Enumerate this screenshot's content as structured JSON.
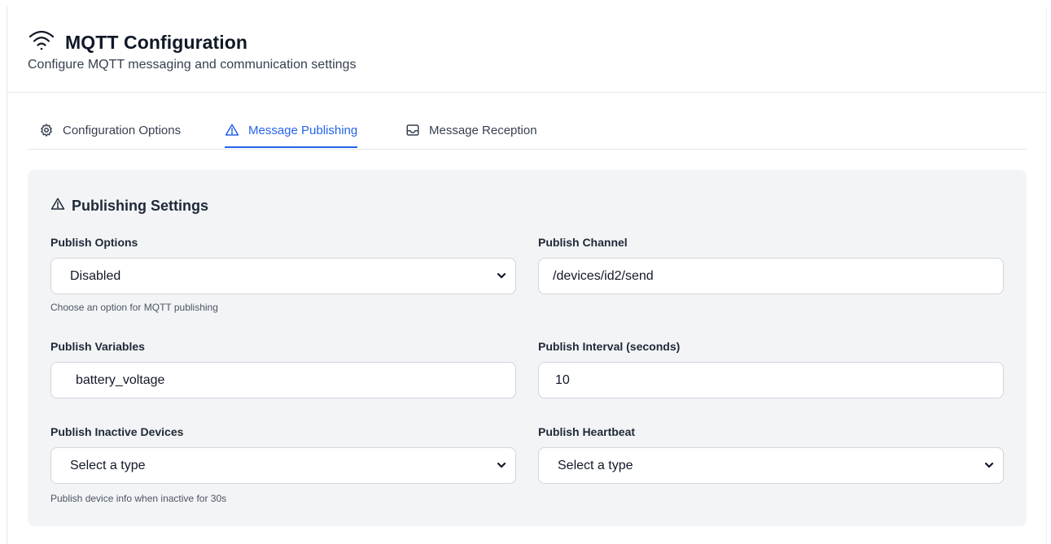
{
  "header": {
    "title": "MQTT Configuration",
    "subtitle": "Configure MQTT messaging and communication settings",
    "icon": "wifi-icon"
  },
  "tabs": [
    {
      "label": "Configuration Options",
      "icon": "gear-icon",
      "active": false
    },
    {
      "label": "Message Publishing",
      "icon": "warning-triangle-icon",
      "active": true
    },
    {
      "label": "Message Reception",
      "icon": "inbox-icon",
      "active": false
    }
  ],
  "panel": {
    "title": "Publishing Settings",
    "icon": "warning-triangle-icon",
    "publish_options": {
      "label": "Publish Options",
      "value": "Disabled",
      "hint": "Choose an option for MQTT publishing"
    },
    "publish_channel": {
      "label": "Publish Channel",
      "value": "/devices/id2/send"
    },
    "publish_variables": {
      "label": "Publish Variables",
      "value": "battery_voltage"
    },
    "publish_interval": {
      "label": "Publish Interval (seconds)",
      "value": "10"
    },
    "publish_inactive": {
      "label": "Publish Inactive Devices",
      "value": "Select a type",
      "hint": "Publish device info when inactive for 30s"
    },
    "publish_heartbeat": {
      "label": "Publish Heartbeat",
      "value": "Select a type"
    }
  },
  "colors": {
    "accent": "#2563eb",
    "panel_bg": "#f3f4f6",
    "border": "#d1d5db"
  }
}
